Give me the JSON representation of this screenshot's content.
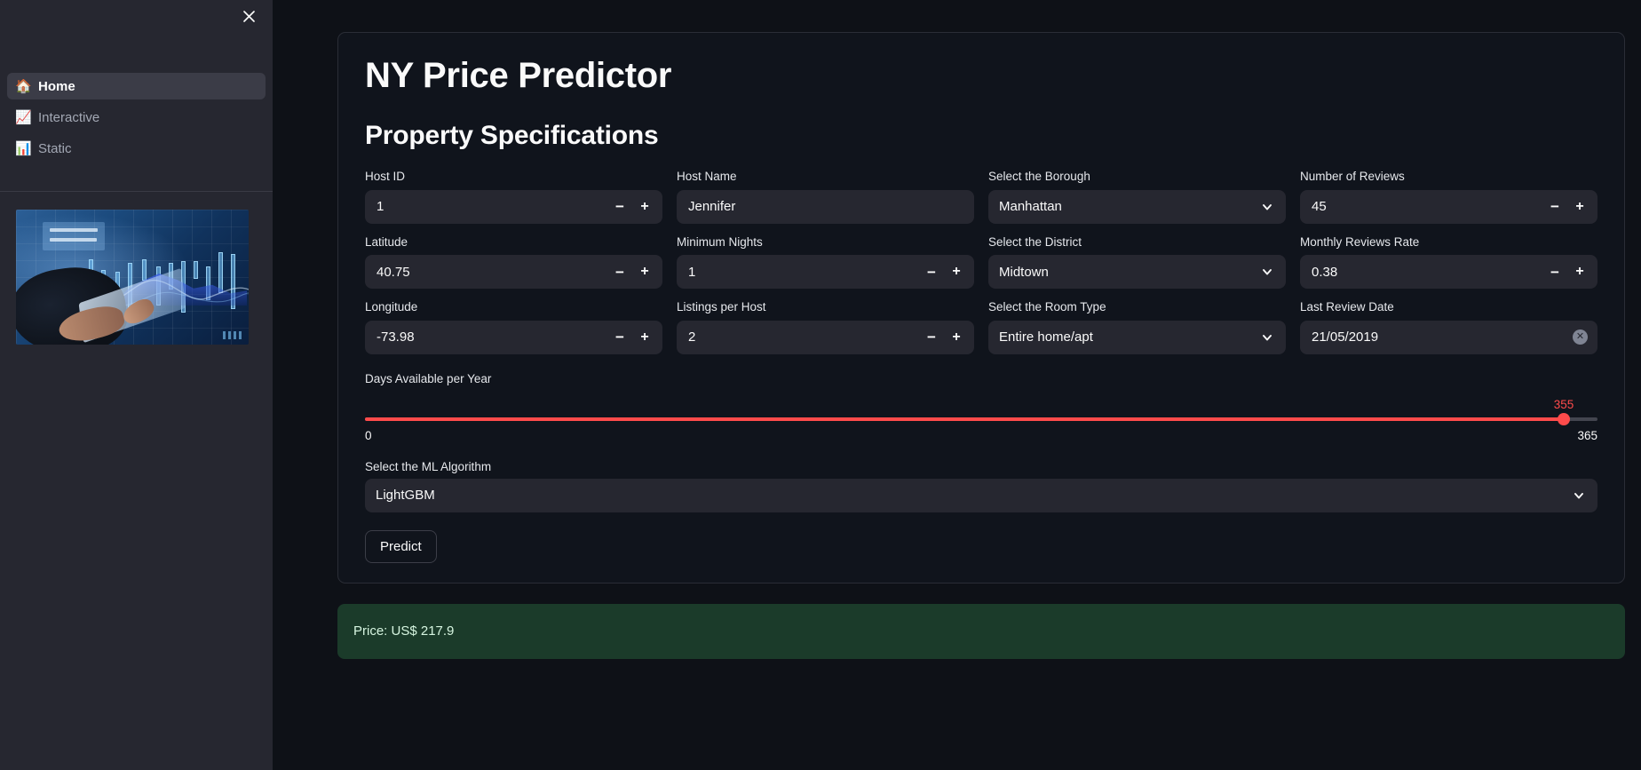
{
  "sidebar": {
    "close_icon": "close-icon",
    "nav_items": [
      {
        "icon": "🏠",
        "icon_name": "house-icon",
        "label": "Home",
        "active": true
      },
      {
        "icon": "📈",
        "icon_name": "chart-increasing-icon",
        "label": "Interactive",
        "active": false
      },
      {
        "icon": "📊",
        "icon_name": "bar-chart-icon",
        "label": "Static",
        "active": false
      }
    ],
    "image_alt": "financial-dashboard-tablet-photo"
  },
  "main": {
    "app_title": "NY Price Predictor",
    "section_title": "Property Specifications",
    "fields": {
      "host_id": {
        "label": "Host ID",
        "value": "1",
        "type": "number"
      },
      "host_name": {
        "label": "Host Name",
        "value": "Jennifer",
        "type": "text"
      },
      "borough": {
        "label": "Select the Borough",
        "value": "Manhattan",
        "type": "select"
      },
      "number_reviews": {
        "label": "Number of Reviews",
        "value": "45",
        "type": "number"
      },
      "latitude": {
        "label": "Latitude",
        "value": "40.75",
        "type": "number"
      },
      "minimum_nights": {
        "label": "Minimum Nights",
        "value": "1",
        "type": "number"
      },
      "district": {
        "label": "Select the District",
        "value": "Midtown",
        "type": "select"
      },
      "monthly_reviews": {
        "label": "Monthly Reviews Rate",
        "value": "0.38",
        "type": "number"
      },
      "longitude": {
        "label": "Longitude",
        "value": "-73.98",
        "type": "number"
      },
      "listings_per_host": {
        "label": "Listings per Host",
        "value": "2",
        "type": "number"
      },
      "room_type": {
        "label": "Select the Room Type",
        "value": "Entire home/apt",
        "type": "select"
      },
      "last_review_date": {
        "label": "Last Review Date",
        "value": "21/05/2019",
        "type": "date"
      }
    },
    "slider": {
      "label": "Days Available per Year",
      "value": "355",
      "min": "0",
      "max": "365",
      "min_num": 0,
      "max_num": 365,
      "value_num": 355,
      "accent_color": "#ff4b4b"
    },
    "ml_algorithm": {
      "label": "Select the ML Algorithm",
      "value": "LightGBM"
    },
    "predict_button": "Predict",
    "result": {
      "text": "Price: US$ 217.9",
      "background_color": "#1b3b2a",
      "text_color": "#d6f5e0"
    },
    "stepper_minus": "−",
    "stepper_plus": "+",
    "date_clear": "✕"
  }
}
